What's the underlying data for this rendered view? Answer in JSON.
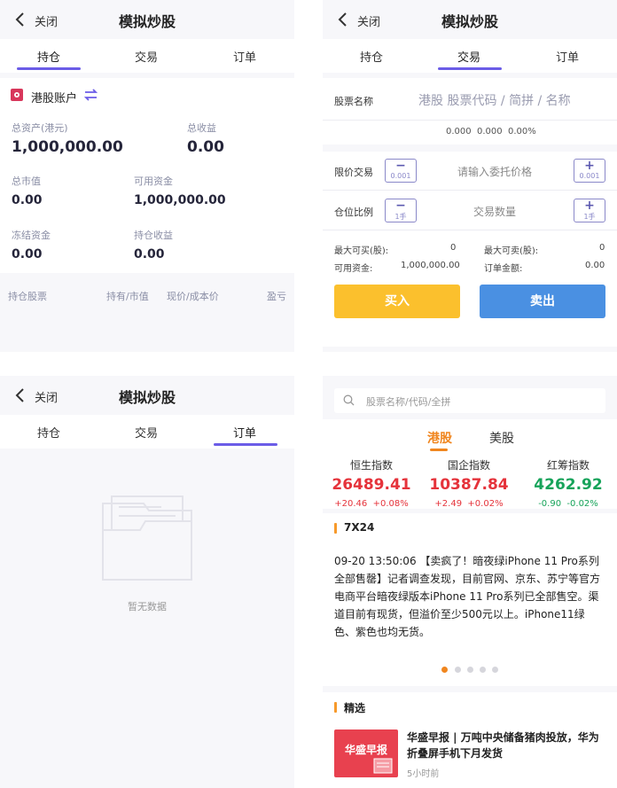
{
  "common": {
    "close": "关闭",
    "title": "模拟炒股",
    "tabs": [
      "持仓",
      "交易",
      "订单"
    ]
  },
  "holdings": {
    "account": "港股账户",
    "total_assets_label": "总资产(港元)",
    "total_assets": "1,000,000.00",
    "total_income_label": "总收益",
    "total_income": "0.00",
    "market_value_label": "总市值",
    "market_value": "0.00",
    "available_label": "可用资金",
    "available": "1,000,000.00",
    "frozen_label": "冻结资金",
    "frozen": "0.00",
    "position_income_label": "持仓收益",
    "position_income": "0.00",
    "columns": [
      "持仓股票",
      "持有/市值",
      "现价/成本价",
      "盈亏"
    ]
  },
  "trade": {
    "stock_label": "股票名称",
    "stock_placeholder": "港股 股票代码 / 简拼 / 名称",
    "quote": [
      "0.000",
      "0.000",
      "0.00%"
    ],
    "limit_label": "限价交易",
    "price_placeholder": "请输入委托价格",
    "price_step": "0.001",
    "ratio_label": "仓位比例",
    "qty_placeholder": "交易数量",
    "qty_step": "1手",
    "max_buy_label": "最大可买(股):",
    "max_buy": "0",
    "max_sell_label": "最大可卖(股):",
    "max_sell": "0",
    "avail_label": "可用资金:",
    "avail": "1,000,000.00",
    "order_amount_label": "订单金额:",
    "order_amount": "0.00",
    "buy": "买入",
    "sell": "卖出",
    "colors": {
      "buy": "#fbc02d",
      "sell": "#4a90e2"
    }
  },
  "orders": {
    "empty": "暂无数据"
  },
  "market": {
    "search_placeholder": "股票名称/代码/全拼",
    "tabs": [
      "港股",
      "美股"
    ],
    "indices": [
      {
        "name": "恒生指数",
        "price": "26489.41",
        "change": "+20.46",
        "pct": "+0.08%",
        "color": "#e5333b"
      },
      {
        "name": "国企指数",
        "price": "10387.84",
        "change": "+2.49",
        "pct": "+0.02%",
        "color": "#e5333b"
      },
      {
        "name": "红筹指数",
        "price": "4262.92",
        "change": "-0.90",
        "pct": "-0.02%",
        "color": "#16a35a"
      }
    ],
    "news_title": "7X24",
    "news_text": "09-20 13:50:06 【卖疯了！暗夜绿iPhone 11 Pro系列全部售罄】记者调查发现，目前官网、京东、苏宁等官方电商平台暗夜绿版本iPhone 11 Pro系列已全部售空。渠道目前有现货，但溢价至少500元以上。iPhone11绿色、紫色也均无货。",
    "picks_title": "精选",
    "article_thumb": "华盛早报",
    "article_title": "华盛早报 | 万吨中央储备猪肉投放，华为折叠屏手机下月发货",
    "article_time": "5小时前"
  }
}
